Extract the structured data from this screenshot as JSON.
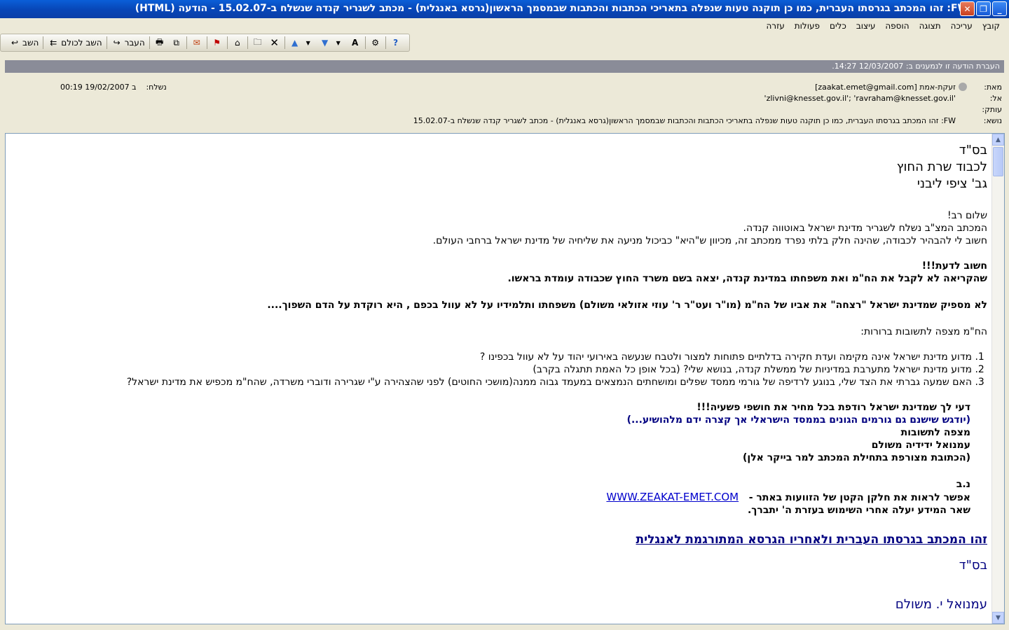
{
  "window": {
    "title": "FW: זהו המכתב בגרסתו העברית, כמו כן תוקנה טעות שנפלה  בתאריכי הכתבות והכתבות שבמסמך הראשון(גרסא באנגלית)  - מכתב  לשגריר קנדה שנשלח ב-15.02.07  - הודעה (HTML)",
    "minimize": "_",
    "restore": "❐",
    "close": "✕"
  },
  "menu": [
    "קובץ",
    "עריכה",
    "תצוגה",
    "הוספה",
    "עיצוב",
    "כלים",
    "פעולות",
    "עזרה"
  ],
  "toolbar": {
    "reply": "השב",
    "reply_all": "השב לכולם",
    "forward": "העבר"
  },
  "infobar": "העברת הודעה זו לנמענים ב: 12/03/2007 14:27.",
  "header": {
    "from_label": "מאת:",
    "from_value": "זעקת-אמת [zaakat.emet@gmail.com]",
    "to_label": "אל:",
    "to_value": "'zlivni@knesset.gov.il'; 'ravraham@knesset.gov.il'",
    "cc_label": "עותק:",
    "cc_value": "",
    "subject_label": "נושא:",
    "subject_value": "FW: זהו המכתב בגרסתו העברית, כמו כן תוקנה טעות שנפלה  בתאריכי הכתבות והכתבות שבמסמך הראשון(גרסא באנגלית)  - מכתב  לשגריר קנדה שנשלח ב-15.02.07",
    "sent_label": "נשלח:",
    "sent_value": "ב 19/02/2007 00:19"
  },
  "body": {
    "l1": "בס\"ד",
    "l2": "לכבוד שרת החוץ",
    "l3": "גב' ציפי ליבני",
    "greet": "שלום רב!",
    "p1": "המכתב המצ\"ב נשלח לשגריר מדינת ישראל באוטווה קנדה.",
    "p2": "חשוב לי להבהיר לכבודה, שהינה חלק בלתי נפרד ממכתב זה, מכיוון ש\"היא\" כביכול מניעה את שליחיה  של מדינת ישראל ברחבי העולם.",
    "imp_title": "חשוב לדעת!!!",
    "imp_text": "שהקריאה לא לקבל את הח\"מ  ואת משפחתו במדינת קנדה, יצאה בשם משרד החוץ שכבודה עומדת בראשו.",
    "not_enough": "לא מספיק שמדינת ישראל \"רצחה\" את אביו של הח\"מ (מו\"ר ועט\"ר ר' עוזי אזולאי משולם) משפחתו ותלמידיו על לא עוול בכפם , היא רוקדת על הדם השפוך....",
    "expects": "הח\"מ מצפה לתשובות ברורות:",
    "q1": "מדוע מדינת ישראל אינה מקימה ועדת חקירה בדלתיים פתוחות למצור ולטבח שנעשה באירועי יהוד על לא עוול בכפינו ?",
    "q2": "מדוע מדינת ישראל מתערבת במדיניות של ממשלת קנדה, בנושא שלי? (בכל אופן כל האמת תתגלה בקרב)",
    "q3": "האם שמעה גברתי את הצד שלי, בנוגע לרדיפה של גורמי ממסד שפלים ומושחתים הנמצאים במעמד גבוה ממנה(מושכי החוטים) לפני שהצהירה ע\"י שגרירה ודוברי משרדה, שהח\"מ מכפיש את מדינת ישראל?",
    "know": "דעי לך שמדינת ישראל רודפת בכל מחיר את חושפי פשעיה!!!",
    "know2": "(יודגש שישנם גם גורמים הגונים בממסד הישראלי אך קצרה ידם מלהושיע...)",
    "await": "מצפה לתשובות",
    "sign": "עמנואל ידידיה משולם",
    "attach": "(הכתובת מצורפת בתחילת המכתב למר בייקר אלן)",
    "nb": "נ.ב",
    "nb1_pre": "אפשר לראות את חלקן הקטן של הזוועות באתר  -",
    "nb1_link": "WWW.ZEAKAT-EMET.COM",
    "nb2": "שאר המידע יעלה אחרי השימוש בעזרת ה' יתברך.",
    "hebver": "זהו המכתב בגרסתו העברית ולאחריו הגרסא המתורגמת לאנגלית",
    "bsd2": "בס\"ד",
    "sig2": "עמנואל י. משולם"
  }
}
